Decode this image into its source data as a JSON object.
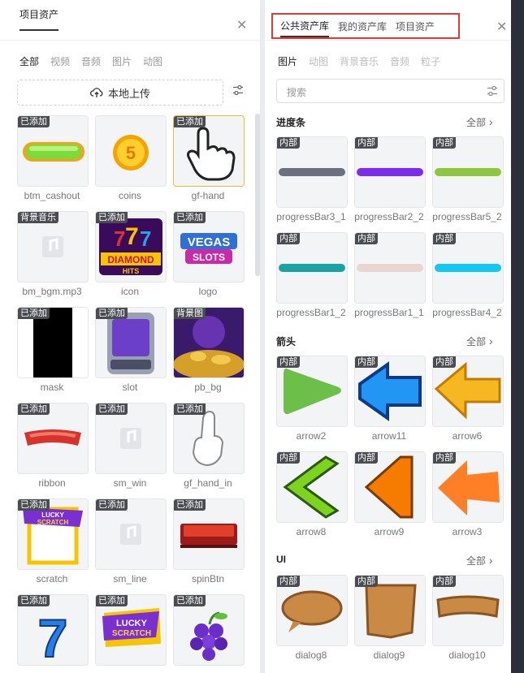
{
  "left": {
    "title": "项目资产",
    "filters": [
      "全部",
      "视频",
      "音频",
      "图片",
      "动图"
    ],
    "upload_label": "本地上传",
    "assets": [
      {
        "name": "btm_cashout",
        "badge": "已添加"
      },
      {
        "name": "coins",
        "badge": ""
      },
      {
        "name": "gf-hand",
        "badge": "已添加"
      },
      {
        "name": "bm_bgm.mp3",
        "badge": "背景音乐"
      },
      {
        "name": "icon",
        "badge": "已添加"
      },
      {
        "name": "logo",
        "badge": "已添加"
      },
      {
        "name": "mask",
        "badge": "已添加"
      },
      {
        "name": "slot",
        "badge": "已添加"
      },
      {
        "name": "pb_bg",
        "badge": "背景图"
      },
      {
        "name": "ribbon",
        "badge": "已添加"
      },
      {
        "name": "sm_win",
        "badge": "已添加"
      },
      {
        "name": "gf_hand_in",
        "badge": "已添加"
      },
      {
        "name": "scratch",
        "badge": "已添加"
      },
      {
        "name": "sm_line",
        "badge": "已添加"
      },
      {
        "name": "spinBtn",
        "badge": "已添加"
      },
      {
        "name": "",
        "badge": "已添加"
      },
      {
        "name": "",
        "badge": "已添加"
      },
      {
        "name": "",
        "badge": "已添加"
      }
    ],
    "coin_digit": "5",
    "icon_text": [
      "DIAMOND",
      "HITS"
    ],
    "logo_text": [
      "VEGAS",
      "SLOTS"
    ],
    "lucky_text": [
      "LUCKY",
      "SCRATCH"
    ],
    "seven_digit": "7"
  },
  "right": {
    "tabs": [
      "公共资产库",
      "我的资产库",
      "项目资产"
    ],
    "subtabs": [
      "图片",
      "动图",
      "背景音乐",
      "音频",
      "粒子"
    ],
    "search_placeholder": "搜索",
    "see_all": "全部",
    "sections": [
      {
        "title": "进度条",
        "items": [
          {
            "name": "progressBar3_1",
            "badge": "内部",
            "color": "#6b6f80"
          },
          {
            "name": "progressBar2_2",
            "badge": "内部",
            "color": "#7b2cf0"
          },
          {
            "name": "progressBar5_2",
            "badge": "内部",
            "color": "#8dc63f"
          },
          {
            "name": "progressBar1_2",
            "badge": "内部",
            "color": "#1aa3a3"
          },
          {
            "name": "progressBar1_1",
            "badge": "内部",
            "color": "#e8d6cf"
          },
          {
            "name": "progressBar4_2",
            "badge": "内部",
            "color": "#12c8f0"
          }
        ]
      },
      {
        "title": "箭头",
        "items": [
          {
            "name": "arrow2",
            "badge": "内部",
            "color": "#6cc04a"
          },
          {
            "name": "arrow11",
            "badge": "内部",
            "color": "#2196f3"
          },
          {
            "name": "arrow6",
            "badge": "内部",
            "color": "#f5b820"
          },
          {
            "name": "arrow8",
            "badge": "内部",
            "color": "#7ed321"
          },
          {
            "name": "arrow9",
            "badge": "内部",
            "color": "#f57c00"
          },
          {
            "name": "arrow3",
            "badge": "内部",
            "color": "#ff7f27"
          }
        ]
      },
      {
        "title": "UI",
        "items": [
          {
            "name": "dialog8",
            "badge": "内部",
            "color": "#c98a46"
          },
          {
            "name": "dialog9",
            "badge": "内部",
            "color": "#c98a46"
          },
          {
            "name": "dialog10",
            "badge": "内部",
            "color": "#c98a46"
          }
        ]
      }
    ]
  }
}
